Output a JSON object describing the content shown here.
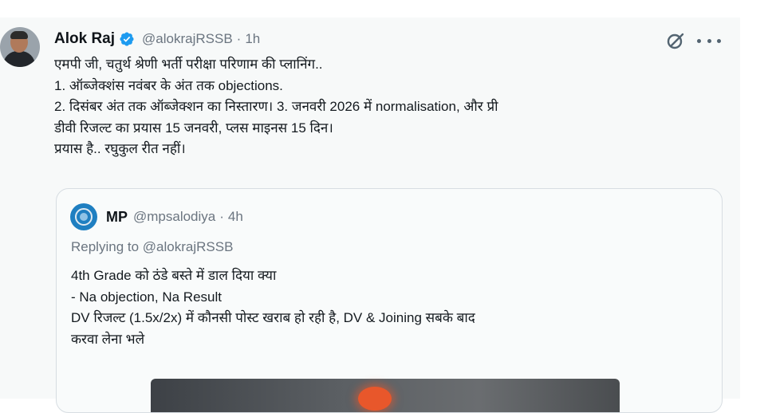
{
  "tweet": {
    "author_name": "Alok Raj",
    "handle": "@alokrajRSSB",
    "separator": "·",
    "time": "1h",
    "lines": [
      "एमपी जी, चतुर्थ श्रेणी भर्ती परीक्षा परिणाम की प्लानिंग..",
      "1. ऑब्जेक्शंस नवंबर के अंत तक objections.",
      "2. दिसंबर अंत तक ऑब्जेक्शन का निस्तारण। 3. जनवरी 2026 में normalisation, और प्री",
      "डीवी रिजल्ट का प्रयास 15 जनवरी, प्लस माइनस 15 दिन।",
      "प्रयास है.. रघुकुल रीत नहीं।"
    ]
  },
  "quote": {
    "author_name": "MP",
    "handle": "@mpsalodiya",
    "separator": "·",
    "time": "4h",
    "replying_prefix": "Replying to",
    "replying_handle": "@alokrajRSSB",
    "lines": [
      "4th Grade को ठंडे बस्ते में डाल दिया क्या",
      "- Na objection, Na Result",
      "DV रिजल्ट (1.5x/2x) में कौनसी पोस्ट खराब हो रही है, DV & Joining सबके बाद",
      "करवा लेना भले"
    ]
  },
  "icons": {
    "verified": "verified-badge-icon",
    "grok": "grok-icon",
    "more": "more-options-icon"
  },
  "colors": {
    "verified_blue": "#1d9bf0",
    "secondary_text": "#6b7580",
    "quote_border": "#d7dde2"
  }
}
